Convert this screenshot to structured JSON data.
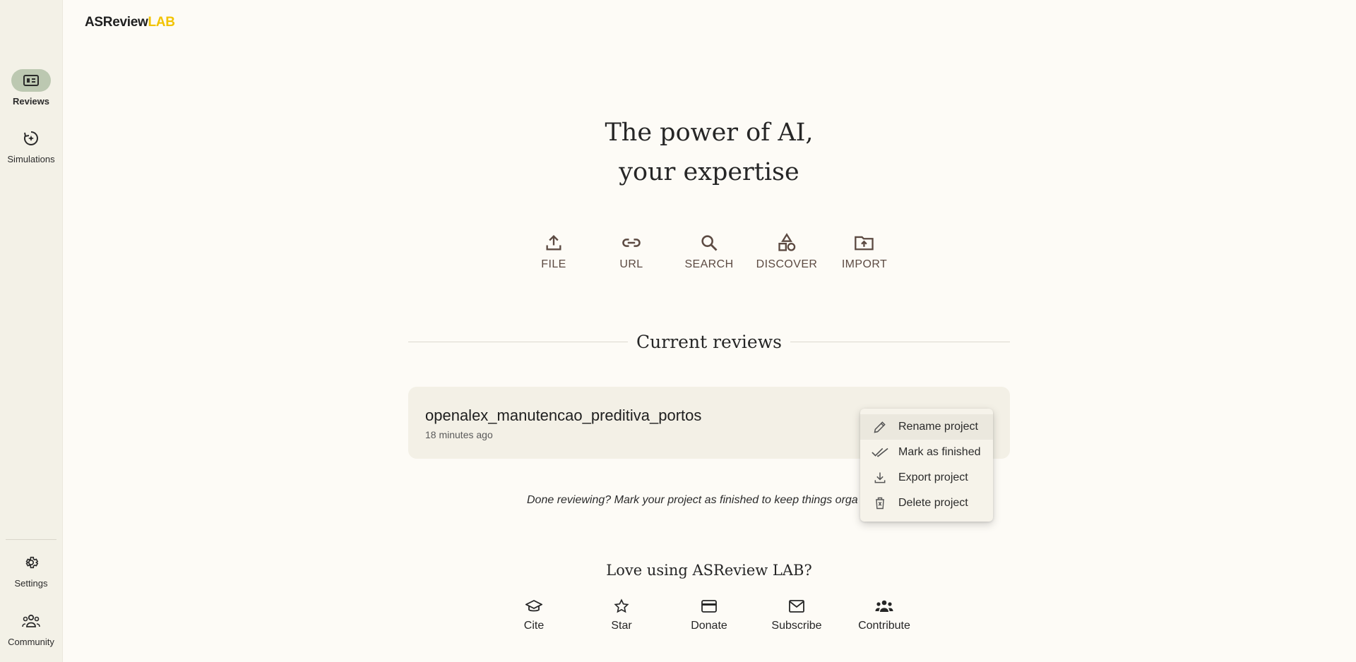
{
  "app": {
    "logo_main": "ASReview",
    "logo_accent": "LAB"
  },
  "sidebar": {
    "items": [
      {
        "label": "Reviews",
        "icon": "reviews-icon",
        "active": true
      },
      {
        "label": "Simulations",
        "icon": "simulations-icon",
        "active": false
      }
    ],
    "bottom_items": [
      {
        "label": "Settings",
        "icon": "gear-icon"
      },
      {
        "label": "Community",
        "icon": "community-icon"
      }
    ]
  },
  "hero": {
    "line1": "The power of AI,",
    "line2": "your expertise"
  },
  "actions": [
    {
      "label": "FILE",
      "icon": "upload-icon"
    },
    {
      "label": "URL",
      "icon": "link-icon"
    },
    {
      "label": "SEARCH",
      "icon": "search-icon"
    },
    {
      "label": "DISCOVER",
      "icon": "discover-icon"
    },
    {
      "label": "IMPORT",
      "icon": "folder-upload-icon"
    }
  ],
  "reviews": {
    "title": "Current reviews",
    "items": [
      {
        "name": "openalex_manutencao_preditiva_portos",
        "time": "18 minutes ago"
      }
    ],
    "hint": "Done reviewing? Mark your project as finished to keep things orga"
  },
  "context_menu": {
    "items": [
      {
        "label": "Rename project",
        "icon": "pencil-icon"
      },
      {
        "label": "Mark as finished",
        "icon": "double-check-icon"
      },
      {
        "label": "Export project",
        "icon": "download-icon"
      },
      {
        "label": "Delete project",
        "icon": "trash-icon"
      }
    ]
  },
  "love": {
    "title": "Love using ASReview LAB?",
    "links": [
      {
        "label": "Cite",
        "icon": "graduation-cap-icon"
      },
      {
        "label": "Star",
        "icon": "star-icon"
      },
      {
        "label": "Donate",
        "icon": "credit-card-icon"
      },
      {
        "label": "Subscribe",
        "icon": "mail-icon"
      },
      {
        "label": "Contribute",
        "icon": "people-icon"
      }
    ]
  },
  "colors": {
    "accent": "#f2c300",
    "active_pill": "#bcc8b1",
    "action_text": "#5c4a42"
  }
}
